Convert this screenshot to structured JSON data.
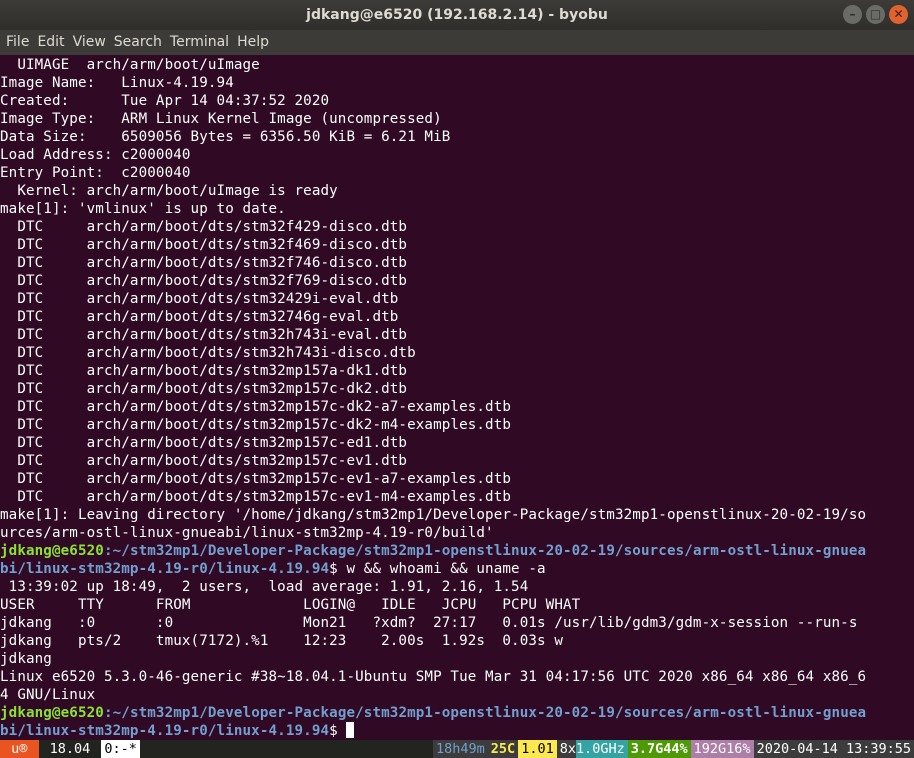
{
  "window": {
    "title": "jdkang@e6520 (192.168.2.14) - byobu",
    "buttons": [
      "–",
      "□",
      "✕"
    ]
  },
  "menu": [
    "File",
    "Edit",
    "View",
    "Search",
    "Terminal",
    "Help"
  ],
  "terminal": {
    "lines": [
      "  UIMAGE  arch/arm/boot/uImage",
      "Image Name:   Linux-4.19.94",
      "Created:      Tue Apr 14 04:37:52 2020",
      "Image Type:   ARM Linux Kernel Image (uncompressed)",
      "Data Size:    6509056 Bytes = 6356.50 KiB = 6.21 MiB",
      "Load Address: c2000040",
      "Entry Point:  c2000040",
      "  Kernel: arch/arm/boot/uImage is ready",
      "make[1]: 'vmlinux' is up to date.",
      "  DTC     arch/arm/boot/dts/stm32f429-disco.dtb",
      "  DTC     arch/arm/boot/dts/stm32f469-disco.dtb",
      "  DTC     arch/arm/boot/dts/stm32f746-disco.dtb",
      "  DTC     arch/arm/boot/dts/stm32f769-disco.dtb",
      "  DTC     arch/arm/boot/dts/stm32429i-eval.dtb",
      "  DTC     arch/arm/boot/dts/stm32746g-eval.dtb",
      "  DTC     arch/arm/boot/dts/stm32h743i-eval.dtb",
      "  DTC     arch/arm/boot/dts/stm32h743i-disco.dtb",
      "  DTC     arch/arm/boot/dts/stm32mp157a-dk1.dtb",
      "  DTC     arch/arm/boot/dts/stm32mp157c-dk2.dtb",
      "  DTC     arch/arm/boot/dts/stm32mp157c-dk2-a7-examples.dtb",
      "  DTC     arch/arm/boot/dts/stm32mp157c-dk2-m4-examples.dtb",
      "  DTC     arch/arm/boot/dts/stm32mp157c-ed1.dtb",
      "  DTC     arch/arm/boot/dts/stm32mp157c-ev1.dtb",
      "  DTC     arch/arm/boot/dts/stm32mp157c-ev1-a7-examples.dtb",
      "  DTC     arch/arm/boot/dts/stm32mp157c-ev1-m4-examples.dtb",
      "make[1]: Leaving directory '/home/jdkang/stm32mp1/Developer-Package/stm32mp1-openstlinux-20-02-19/so",
      "urces/arm-ostl-linux-gnueabi/linux-stm32mp-4.19-r0/build'"
    ],
    "prompt1": {
      "user": "jdkang@e6520",
      "path1": ":~/stm32mp1/Developer-Package/stm32mp1-openstlinux-20-02-19/sources/arm-ostl-linux-gnuea",
      "path2": "bi/linux-stm32mp-4.19-r0/linux-4.19.94",
      "symbol": "$",
      "command": " w && whoami && uname -a"
    },
    "output": [
      " 13:39:02 up 18:49,  2 users,  load average: 1.91, 2.16, 1.54",
      "USER     TTY      FROM             LOGIN@   IDLE   JCPU   PCPU WHAT",
      "jdkang   :0       :0               Mon21   ?xdm?  27:17   0.01s /usr/lib/gdm3/gdm-x-session --run-s",
      "jdkang   pts/2    tmux(7172).%1    12:23    2.00s  1.92s  0.03s w",
      "jdkang",
      "Linux e6520 5.3.0-46-generic #38~18.04.1-Ubuntu SMP Tue Mar 31 04:17:56 UTC 2020 x86_64 x86_64 x86_6",
      "4 GNU/Linux"
    ],
    "prompt2": {
      "user": "jdkang@e6520",
      "path1": ":~/stm32mp1/Developer-Package/stm32mp1-openstlinux-20-02-19/sources/arm-ostl-linux-gnuea",
      "path2": "bi/linux-stm32mp-4.19-r0/linux-4.19.94",
      "symbol": "$ "
    }
  },
  "statusbar": {
    "logo": " u® ",
    "os": " 18.04 ",
    "window": "0:-*",
    "uptime": "18h49m",
    "temp": "25C",
    "load": "1.01",
    "cpu_count": "8x",
    "cpu_freq": "1.0GHz",
    "mem": "3.7G44%",
    "disk": "192G16%",
    "datetime": "2020-04-14 13:39:55"
  },
  "colors": {
    "background": "#300a24",
    "prompt_user": "#8ae234",
    "prompt_path": "#729fcf",
    "logo_bg": "#e95420"
  }
}
